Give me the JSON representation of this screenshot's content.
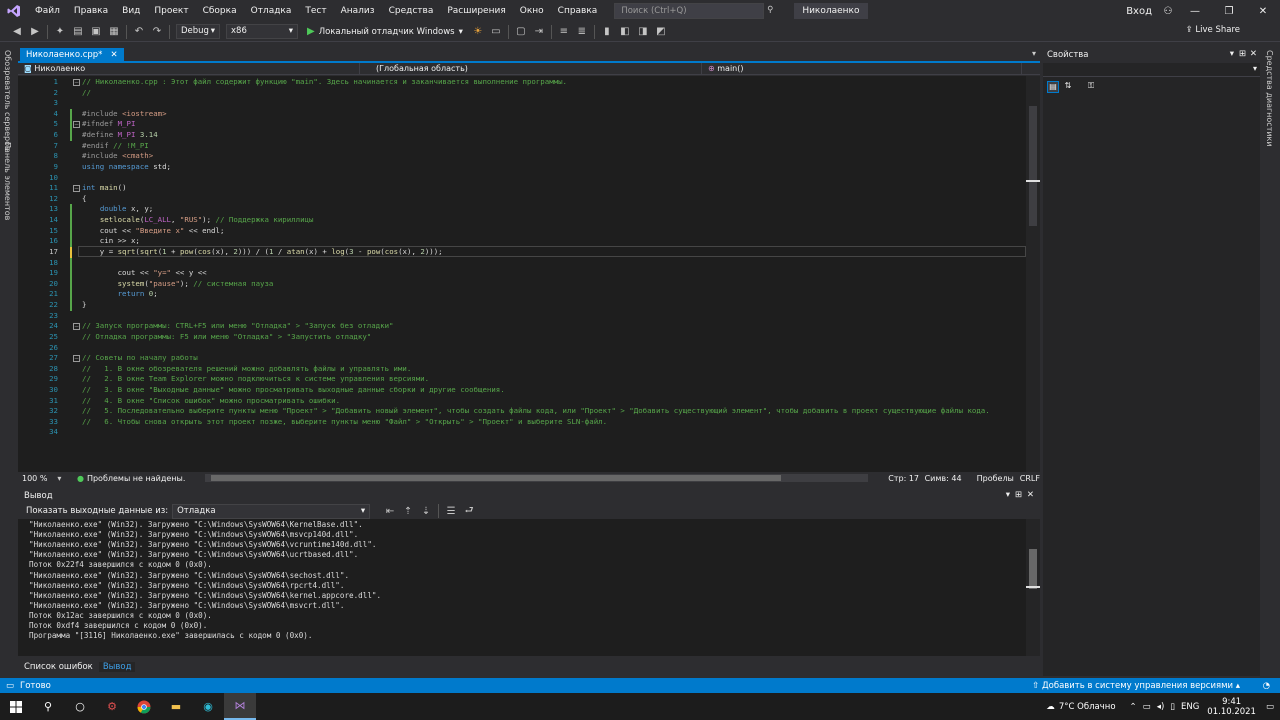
{
  "menu": {
    "items": [
      "Файл",
      "Правка",
      "Вид",
      "Проект",
      "Сборка",
      "Отладка",
      "Тест",
      "Анализ",
      "Средства",
      "Расширения",
      "Окно",
      "Справка"
    ],
    "search_placeholder": "Поиск (Ctrl+Q)",
    "project_name": "Николаенко",
    "login": "Вход"
  },
  "toolbar": {
    "config": "Debug",
    "platform": "x86",
    "run_label": "Локальный отладчик Windows",
    "live_share": "Live Share"
  },
  "left_tabs": [
    "Обозреватель серверов",
    "Панель элементов"
  ],
  "right_tabs": [
    "Средства диагностики"
  ],
  "doc_tab": {
    "title": "Николаенко.cpp*"
  },
  "navbar": {
    "project": "Николаенко",
    "scope": "(Глобальная область)",
    "member": "main()"
  },
  "code_lines": [
    "// Николаенко.cpp : Этот файл содержит функцию \"main\". Здесь начинается и заканчивается выполнение программы.",
    "//",
    "",
    "#include <iostream>",
    "#ifndef M_PI",
    "#define M_PI 3.14",
    "#endif // !M_PI",
    "#include <cmath>",
    "using namespace std;",
    "",
    "int main()",
    "{",
    "    double x, y;",
    "    setlocale(LC_ALL, \"RUS\"); // Поддержка кириллицы",
    "    cout << \"Введите x\" << endl;",
    "    cin >> x;",
    "    y = sqrt(sqrt(1 + pow(cos(x), 2))) / (1 / atan(x) + log(3 - pow(cos(x), 2)));",
    "",
    "        cout << \"y=\" << y <<",
    "        system(\"pause\"); // системная пауза",
    "        return 0;",
    "}",
    "",
    "// Запуск программы: CTRL+F5 или меню \"Отладка\" > \"Запуск без отладки\"",
    "// Отладка программы: F5 или меню \"Отладка\" > \"Запустить отладку\"",
    "",
    "// Советы по началу работы",
    "//   1. В окне обозревателя решений можно добавлять файлы и управлять ими.",
    "//   2. В окне Team Explorer можно подключиться к системе управления версиями.",
    "//   3. В окне \"Выходные данные\" можно просматривать выходные данные сборки и другие сообщения.",
    "//   4. В окне \"Список ошибок\" можно просматривать ошибки.",
    "//   5. Последовательно выберите пункты меню \"Проект\" > \"Добавить новый элемент\", чтобы создать файлы кода, или \"Проект\" > \"Добавить существующий элемент\", чтобы добавить в проект существующие файлы кода.",
    "//   6. Чтобы снова открыть этот проект позже, выберите пункты меню \"Файл\" > \"Открыть\" > \"Проект\" и выберите SLN-файл.",
    ""
  ],
  "editor_status": {
    "zoom": "100 %",
    "problems": "Проблемы не найдены.",
    "line": "Стр: 17",
    "col": "Симв: 44",
    "spaces": "Пробелы",
    "eol": "CRLF"
  },
  "output": {
    "title": "Вывод",
    "show_from_label": "Показать выходные данные из:",
    "source": "Отладка",
    "lines": [
      "\"Николаенко.exe\" (Win32). Загружено \"C:\\Windows\\SysWOW64\\KernelBase.dll\".",
      "\"Николаенко.exe\" (Win32). Загружено \"C:\\Windows\\SysWOW64\\msvcp140d.dll\".",
      "\"Николаенко.exe\" (Win32). Загружено \"C:\\Windows\\SysWOW64\\vcruntime140d.dll\".",
      "\"Николаенко.exe\" (Win32). Загружено \"C:\\Windows\\SysWOW64\\ucrtbased.dll\".",
      "Поток 0x22f4 завершился с кодом 0 (0x0).",
      "\"Николаенко.exe\" (Win32). Загружено \"C:\\Windows\\SysWOW64\\sechost.dll\".",
      "\"Николаенко.exe\" (Win32). Загружено \"C:\\Windows\\SysWOW64\\rpcrt4.dll\".",
      "\"Николаенко.exe\" (Win32). Загружено \"C:\\Windows\\SysWOW64\\kernel.appcore.dll\".",
      "\"Николаенко.exe\" (Win32). Загружено \"C:\\Windows\\SysWOW64\\msvcrt.dll\".",
      "Поток 0x12ac завершился с кодом 0 (0x0).",
      "Поток 0xdf4 завершился с кодом 0 (0x0).",
      "Программа \"[3116] Николаенко.exe\" завершилась с кодом 0 (0x0)."
    ]
  },
  "bottom_tabs": [
    "Список ошибок",
    "Вывод"
  ],
  "properties": {
    "title": "Свойства"
  },
  "status_bar": {
    "ready": "Готово",
    "vcs": "Добавить в систему управления версиями"
  },
  "taskbar": {
    "weather": "7°C Облачно",
    "lang": "ENG",
    "time": "9:41",
    "date": "01.10.2021"
  },
  "colors": {
    "accent": "#007acc",
    "background": "#1e1e1e",
    "chrome": "#2d2d30"
  }
}
